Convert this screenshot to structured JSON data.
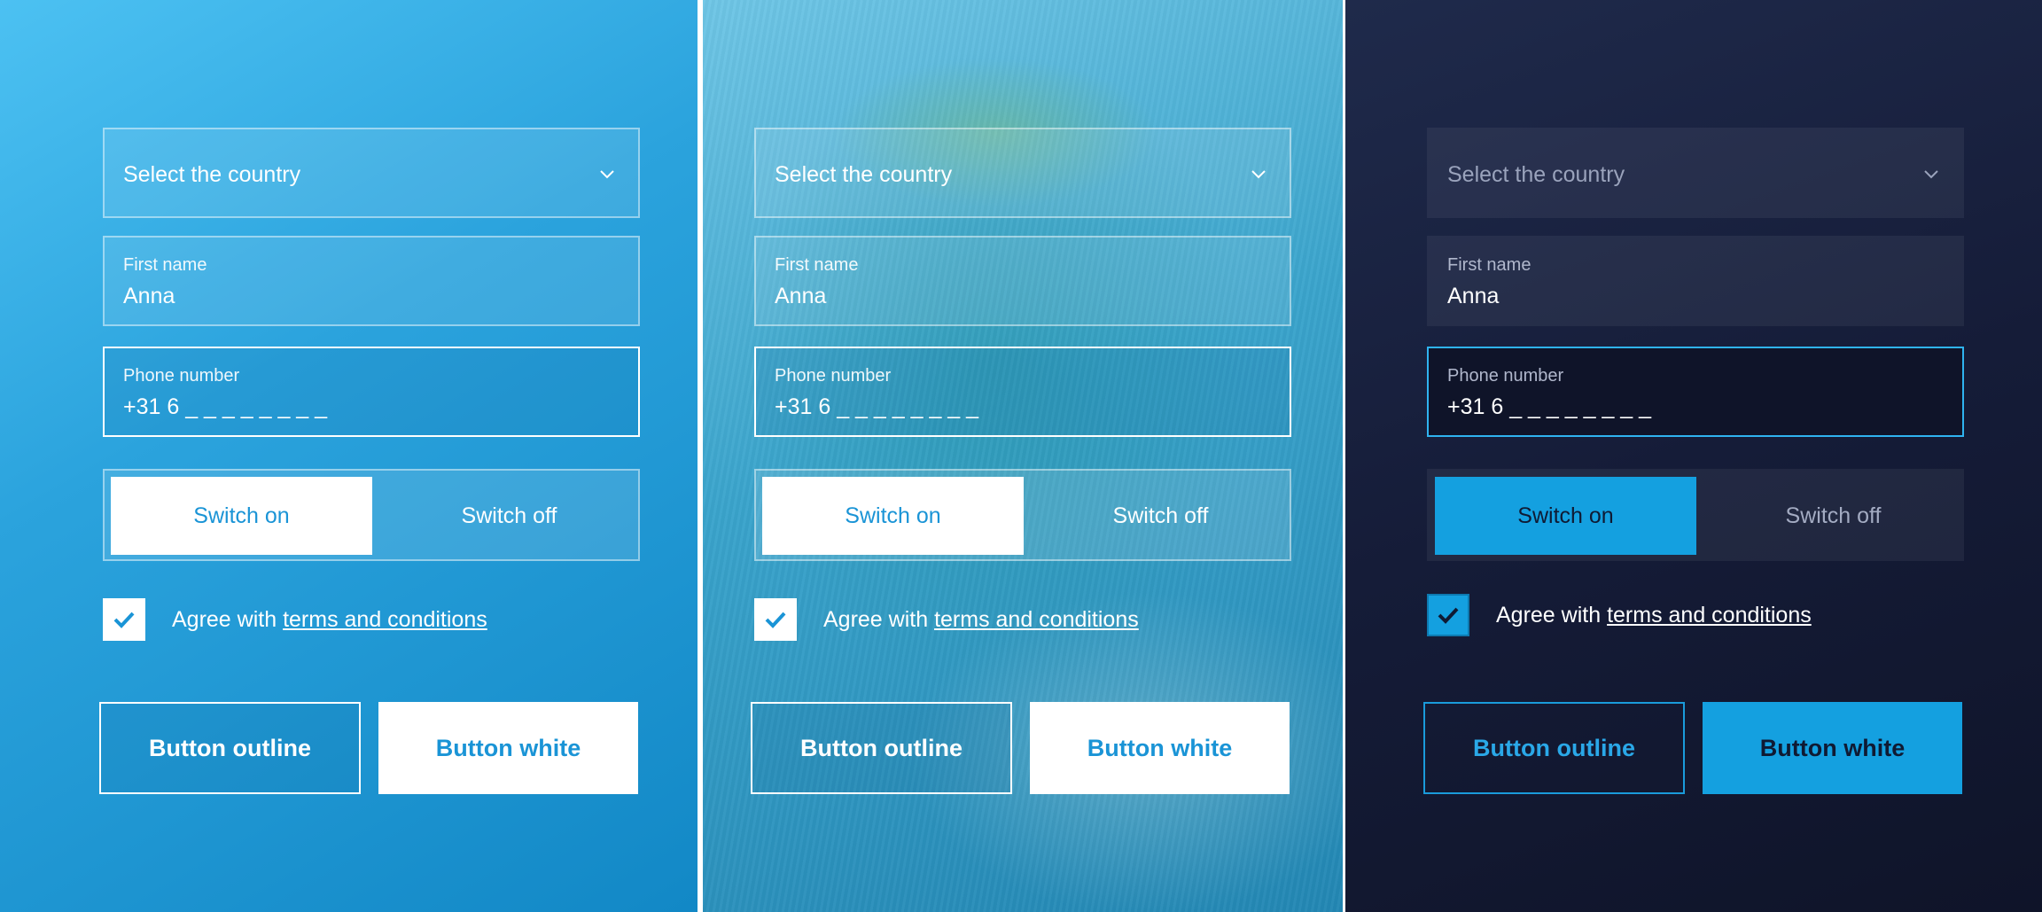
{
  "colors": {
    "accent_blue": "#1a94d6",
    "dark_bg": "#151c38",
    "dark_accent": "#14a0e0"
  },
  "form": {
    "country_placeholder": "Select the country",
    "first_name_label": "First name",
    "first_name_value": "Anna",
    "phone_label": "Phone number",
    "phone_value": "+31 6 _ _  _ _  _ _  _ _",
    "switch_on_label": "Switch on",
    "switch_off_label": "Switch off",
    "agree_prefix": "Agree with ",
    "agree_link": "terms and conditions",
    "checkbox_checked": true,
    "button_outline_label": "Button outline",
    "button_white_label": "Button white"
  },
  "panels": [
    {
      "theme": "blue-gradient",
      "selected_switch": "Switch on"
    },
    {
      "theme": "photo-background",
      "selected_switch": "Switch on"
    },
    {
      "theme": "dark",
      "selected_switch": "Switch on"
    }
  ]
}
